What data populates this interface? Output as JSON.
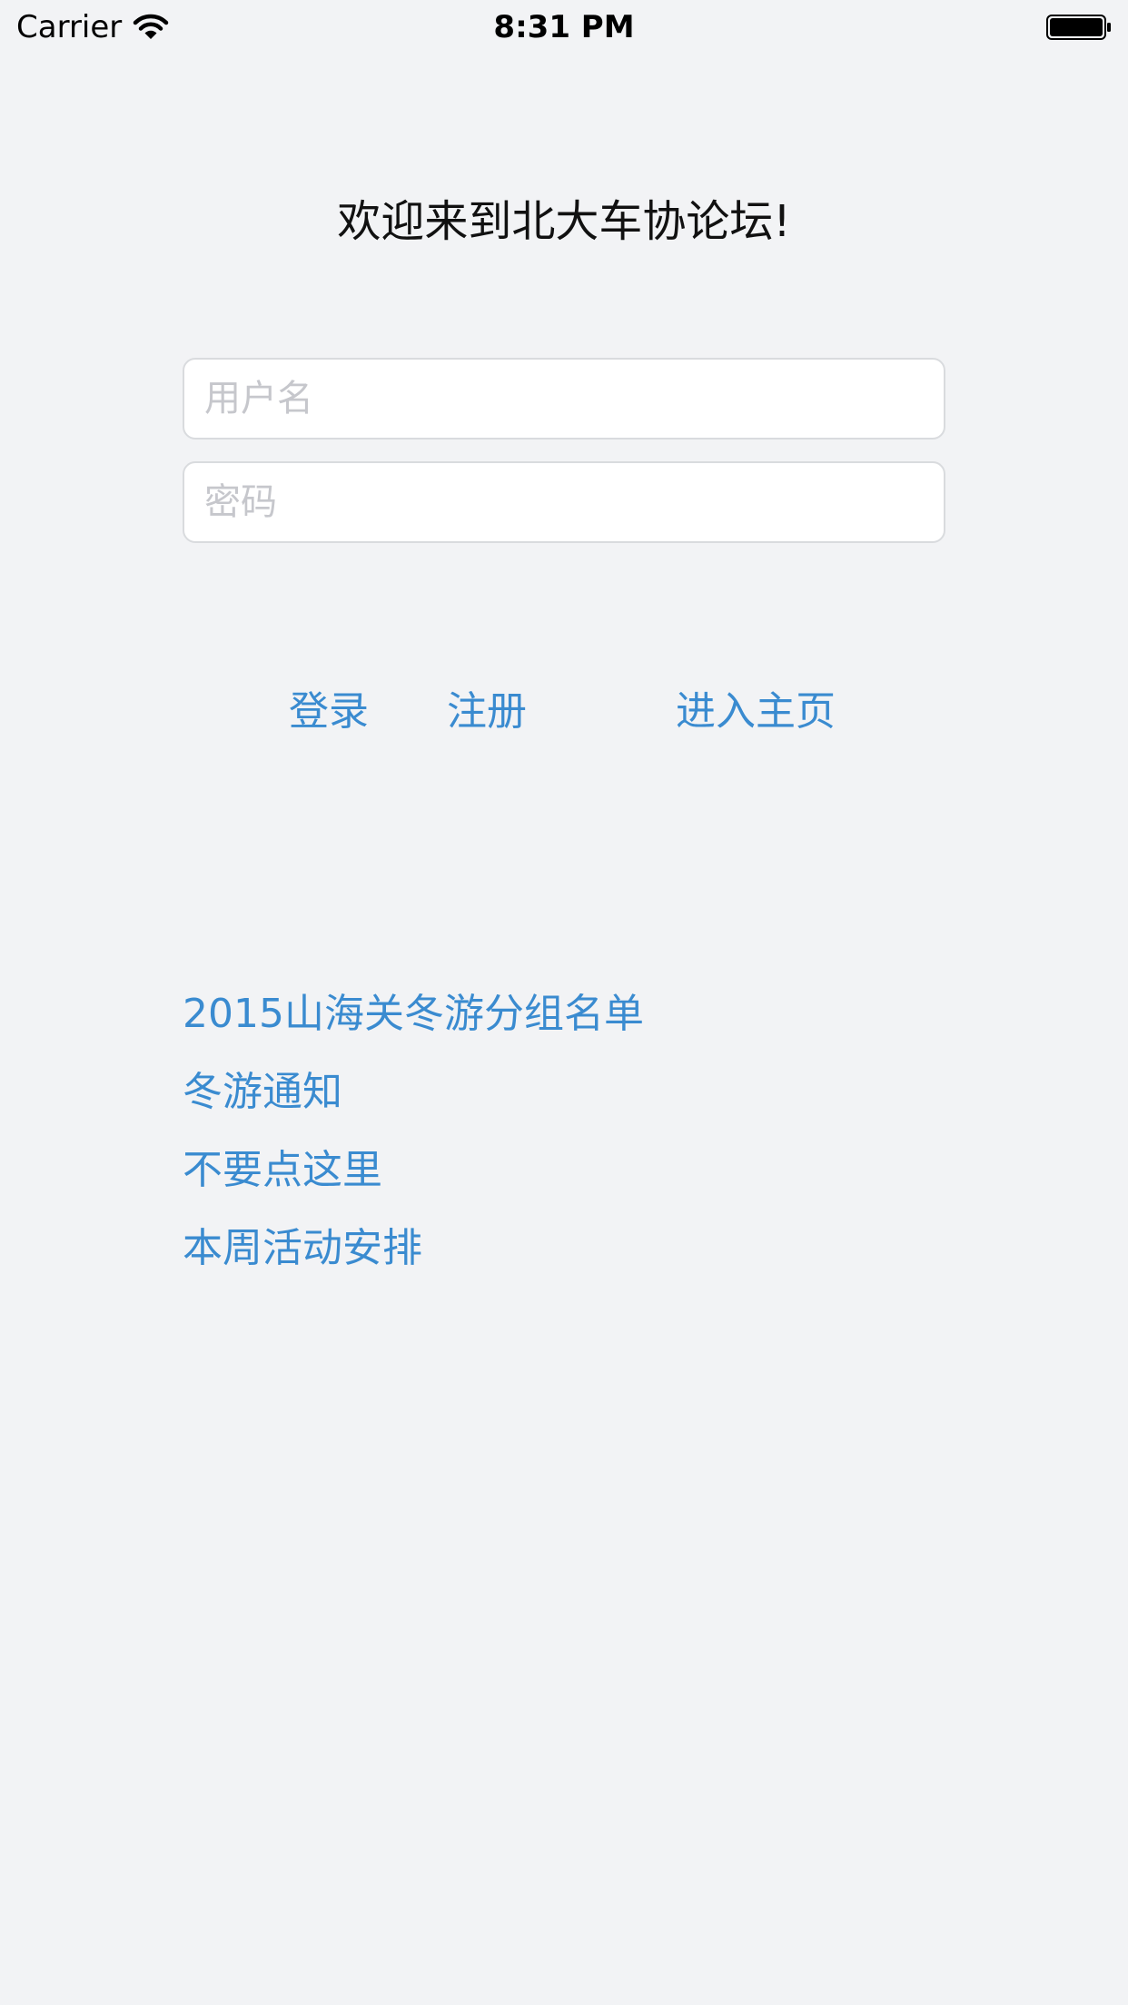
{
  "status_bar": {
    "carrier": "Carrier",
    "time": "8:31 PM",
    "wifi_icon": "wifi-icon",
    "battery_icon": "battery-icon"
  },
  "welcome_text": "欢迎来到北大车协论坛!",
  "form": {
    "username_placeholder": "用户名",
    "username_value": "",
    "password_placeholder": "密码",
    "password_value": ""
  },
  "actions": {
    "login": "登录",
    "register": "注册",
    "home": "进入主页"
  },
  "news_links": [
    "2015山海关冬游分组名单",
    "冬游通知",
    "不要点这里",
    "本周活动安排"
  ],
  "colors": {
    "background": "#f2f3f5",
    "link": "#3a8bd0",
    "placeholder": "#c6c7cc"
  }
}
